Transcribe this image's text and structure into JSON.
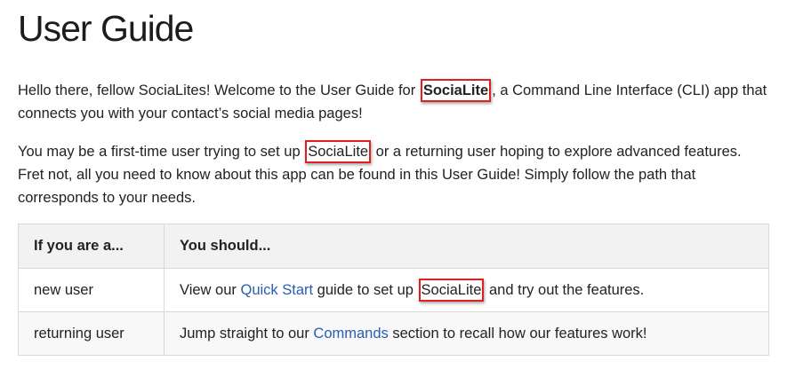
{
  "title": "User Guide",
  "para1": {
    "text_a": "Hello there, fellow SociaLites! Welcome to the User Guide for ",
    "highlight": "SociaLite",
    "text_b": ", a Command Line Interface (CLI) app that connects you with your contact’s social media pages!"
  },
  "para2": {
    "text_a": "You may be a first-time user trying to set up ",
    "highlight": "SociaLite",
    "text_b": " or a returning user hoping to explore advanced features. Fret not, all you need to know about this app can be found in this User Guide! Simply follow the path that corresponds to your needs."
  },
  "table": {
    "headers": [
      "If you are a...",
      "You should..."
    ],
    "rows": [
      {
        "who": "new user",
        "text_a": "View our ",
        "link": "Quick Start",
        "text_b": " guide to set up ",
        "highlight": "SociaLite",
        "text_c": " and try out the features."
      },
      {
        "who": "returning user",
        "text_a": "Jump straight to our ",
        "link": "Commands",
        "text_b": " section to recall how our features work!"
      }
    ]
  },
  "colors": {
    "highlight_border": "#e0201e",
    "link": "#2a5db0",
    "header_bg": "#f2f2f2"
  }
}
